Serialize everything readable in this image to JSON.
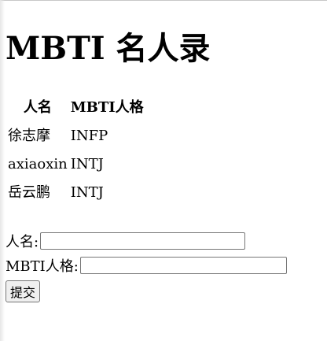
{
  "page": {
    "title": "MBTI 名人录"
  },
  "table": {
    "headers": [
      "人名",
      "MBTI人格"
    ],
    "rows": [
      {
        "name": "徐志摩",
        "type": "INFP"
      },
      {
        "name": "axiaoxin",
        "type": "INTJ"
      },
      {
        "name": "岳云鹏",
        "type": "INTJ"
      }
    ]
  },
  "form": {
    "name_label": "人名:",
    "name_value": "",
    "type_label": "MBTI人格:",
    "type_value": "",
    "submit_label": "提交"
  }
}
